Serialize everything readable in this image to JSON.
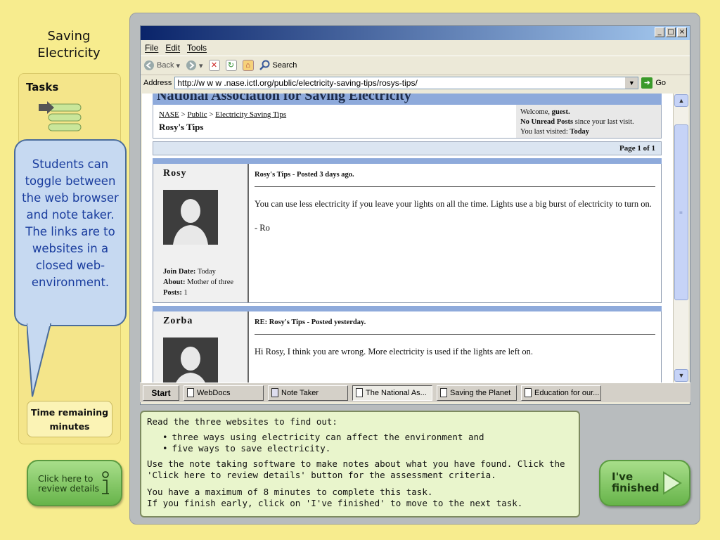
{
  "app": {
    "title_line1": "Saving",
    "title_line2": "Electricity"
  },
  "tasks": {
    "label": "Tasks",
    "callout_text": "Students can toggle between the web browser and note taker. The links are to websites in a closed web-environment."
  },
  "time": {
    "label_line1": "Time remaining",
    "label_line2": "minutes"
  },
  "review_button": {
    "line1": "Click here to",
    "line2": "review details"
  },
  "finished_button": {
    "line1": "I've",
    "line2": "finished"
  },
  "browser": {
    "menu": [
      "File",
      "Edit",
      "Tools"
    ],
    "toolbar": {
      "back": "Back",
      "search": "Search"
    },
    "address_label": "Address",
    "url": "http://w w w .nase.ictl.org/public/electricity-saving-tips/rosys-tips/",
    "go_label": "Go",
    "window_buttons": [
      "_",
      "□",
      "×"
    ]
  },
  "forum": {
    "banner": "National Association for Saving Electricity",
    "breadcrumb": [
      "NASE",
      "Public",
      "Electricity Saving Tips"
    ],
    "breadcrumb_sep": ">",
    "thread_title": "Rosy's Tips",
    "welcome_prefix": "Welcome,",
    "welcome_user": "guest.",
    "unread_bold": "No Unread Posts",
    "unread_rest": "since your last visit.",
    "last_visited_label": "You last visited:",
    "last_visited_value": "Today",
    "page_info": "Page 1 of 1",
    "posts": [
      {
        "user": "Rosy",
        "header": "Rosy's Tips - Posted 3 days ago.",
        "body": "You can use less electricity if you leave your lights on all the time. Lights use a big burst of electricity to turn on.",
        "signature": "- Ro",
        "join_label": "Join Date:",
        "join_value": "Today",
        "about_label": "About:",
        "about_value": "Mother of three",
        "posts_label": "Posts:",
        "posts_value": "1"
      },
      {
        "user": "Zorba",
        "header_bold": "RE: Rosy's Tips",
        "header_rest": " - Posted yesterday.",
        "body": "Hi Rosy, I think you are wrong. More electricity is used if the lights are left on."
      }
    ]
  },
  "taskbar": {
    "start": "Start",
    "items": [
      "WebDocs",
      "Note Taker",
      "The National As...",
      "Saving the Planet",
      "Education for our..."
    ]
  },
  "instructions": {
    "intro": "Read the three websites to find out:",
    "bullets": [
      "three ways using electricity can affect the environment and",
      "five ways to save electricity."
    ],
    "para1": "Use the note taking software to make notes about what you have found. Click the 'Click here to review details' button for the assessment criteria.",
    "para2_line1": "You have a maximum of 8 minutes to complete this task.",
    "para2_line2": "If you finish early, click on 'I've finished' to move to the next task."
  }
}
